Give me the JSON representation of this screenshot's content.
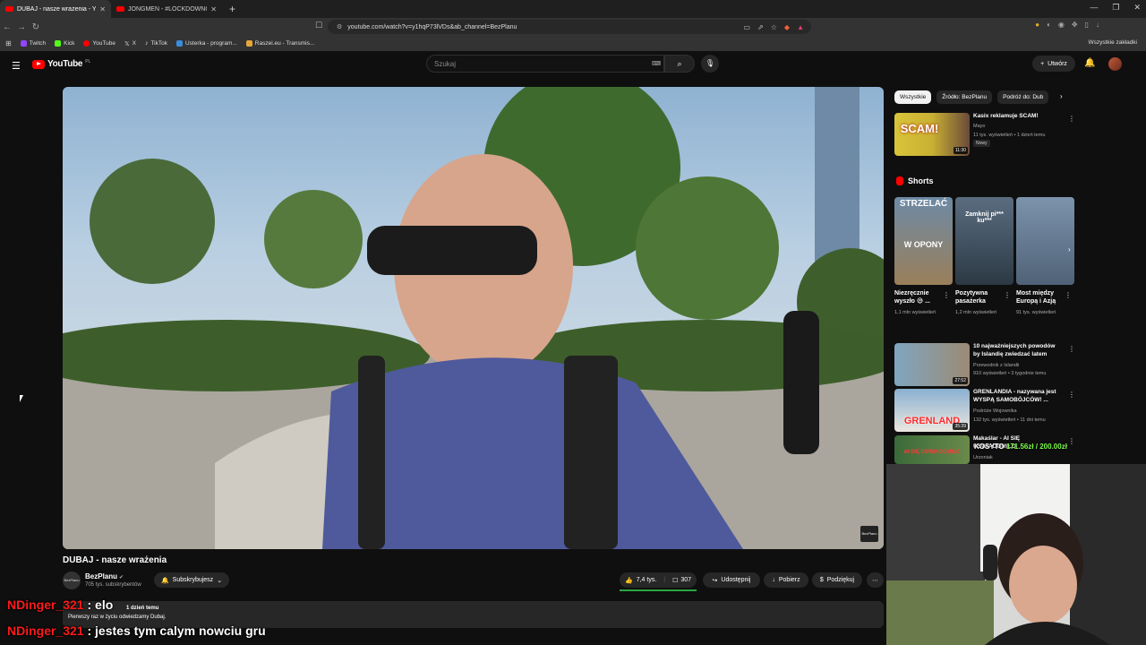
{
  "browser": {
    "tabs": [
      {
        "label": "DUBAJ - nasze wrażenia - YouTube"
      },
      {
        "label": "JONGMEN - #LOCKDOWNCHALLENGE"
      }
    ],
    "url": "youtube.com/watch?v=y1hqP73lVDs&ab_channel=BezPlanu",
    "bookmarks": [
      "Twitch",
      "Kick",
      "YouTube",
      "X",
      "TikTok",
      "Usterka - program...",
      "Raszei.eu - Transmis..."
    ],
    "all_bookmarks": "Wszystkie zakładki"
  },
  "youtube": {
    "logo": "YouTube",
    "logo_region": "PL",
    "search_placeholder": "Szukaj",
    "create_label": "Utwórz"
  },
  "video": {
    "title": "DUBAJ - nasze wrażenia",
    "channel": "BezPlanu",
    "subs": "705 tys. subskrybentów",
    "subscribe_label": "Subskrybujesz",
    "likes": "7,4 tys.",
    "comments": "307",
    "share_label": "Udostępnij",
    "download_label": "Pobierz",
    "thanks_label": "Podziękuj",
    "watermark": "BezPlanu",
    "desc_meta": "1 dzień temu",
    "desc_text": "Pierwszy raz w życiu odwiedzamy Dubaj."
  },
  "sidebar": {
    "chips": [
      "Wszystkie",
      "Źródło: BezPlanu",
      "Podróż do: Dub"
    ],
    "shorts_title": "Shorts",
    "recs": [
      {
        "title": "Kasix reklamuje SCAM!",
        "channel": "Mayo",
        "meta": "11 tys. wyświetleń • 1 dzień temu",
        "badge": "Nowy",
        "duration": "11:30",
        "thumb_text": "SCAM!"
      },
      {
        "title": "10 najważniejszych powodów by Islandię zwiedzać latem",
        "channel": "Przewodnik z Islandii",
        "meta": "910 wyświetleń • 3 tygodnie temu",
        "duration": "27:52"
      },
      {
        "title": "GRENLANDIA - nazywana jest WYSPĄ SAMOBÓJCÓW! ...",
        "channel": "Podróże Wojownika",
        "meta": "132 tys. wyświetleń • 11 dni temu",
        "duration": "35:39",
        "thumb_text": "GRENLAND"
      },
      {
        "title": "Makaślar - AI SIĘ USWIADOMIŁO",
        "channel": "Urzoniak",
        "thumb_text": "AI SIĘ USWIADOMIŁO"
      }
    ],
    "shorts": [
      {
        "title": "Niezręcznie wyszło 😅 ...",
        "views": "1,1 mln wyświetleń",
        "thumb_top": "STRZELAĆ",
        "thumb_bottom": "W OPONY"
      },
      {
        "title": "Pozytywna pasażerka",
        "views": "1,2 mln wyświetleń",
        "thumb_top": "Zamknij pi*** ku***"
      },
      {
        "title": "Most między Europą i Azją",
        "views": "91 tys. wyświetleń"
      }
    ]
  },
  "stream": {
    "donate_label": "KOSYTO",
    "donate_amount": "171.56zł / 200.00zł",
    "chat": [
      {
        "user": "NDinger_321",
        "text": " : elo"
      },
      {
        "user": "NDinger_321",
        "text": " : jestes tym calym nowciu gru"
      }
    ]
  },
  "colors": {
    "yt_red": "#ff0000",
    "bg": "#0f0f0f",
    "chip_bg": "#272727",
    "like_bar": "#2ba640",
    "donate": "#7cfc4a",
    "chat_user": "#ff1a1a"
  }
}
